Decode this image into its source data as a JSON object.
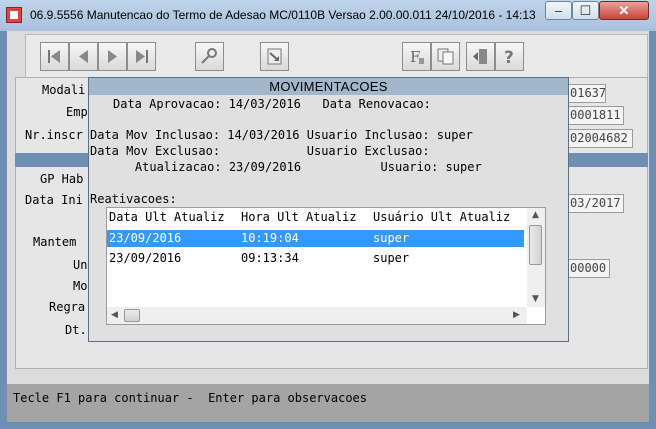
{
  "window": {
    "title": "06.9.5556 Manutencao  do Termo de Adesao MC/0110B Versao 2.00.00.011 24/10/2016 - 14:13",
    "minimize_glyph": "–",
    "maximize_glyph": "☐",
    "close_glyph": "✕"
  },
  "toolbar": {
    "icons": [
      "first-record-icon",
      "previous-record-icon",
      "next-record-icon",
      "last-record-icon",
      "search-key-icon",
      "goto-record-icon",
      "filter-icon",
      "copy-documents-icon",
      "exit-door-icon",
      "help-question-icon"
    ]
  },
  "background_form": {
    "labels": {
      "modal": "Modali",
      "emp": "Emp",
      "nr_inscr": "Nr.inscr",
      "gp_hab": "GP Hab",
      "data_ini": "Data Ini",
      "mantem": "Mantem",
      "un": "Un",
      "mo": "Mo",
      "regra": "Regra",
      "dt": "Dt."
    },
    "values": {
      "field1": "01637",
      "field2": "0001811",
      "field3": "02004682",
      "field4": "03/2017",
      "field5": "00000"
    }
  },
  "dialog": {
    "title": "MOVIMENTACOES",
    "line_aprovacao": "Data Aprovacao: 14/03/2016   Data Renovacao:",
    "line_inclusao": "Data Mov Inclusao: 14/03/2016 Usuario Inclusao: super",
    "line_exclusao": "Data Mov Exclusao:            Usuario Exclusao:",
    "line_atualizacao": "    Atualizacao: 23/09/2016           Usuario: super",
    "reativacoes_label": "Reativacoes:",
    "grid": {
      "columns": [
        "Data Ult Atualiz",
        "Hora Ult Atualiz",
        "Usuário Ult Atualiz"
      ],
      "rows": [
        {
          "date": "23/09/2016",
          "time": "10:19:04",
          "user": "super",
          "selected": true
        },
        {
          "date": "23/09/2016",
          "time": "09:13:34",
          "user": "super",
          "selected": false
        }
      ]
    }
  },
  "status": {
    "text": "Tecle F1 para continuar -  Enter para observacoes"
  },
  "colors": {
    "title_bar": "#a9c1dc",
    "dialog_title": "#a2b6cc",
    "selection": "#3399ff",
    "status_bar": "#a4a4a4"
  }
}
